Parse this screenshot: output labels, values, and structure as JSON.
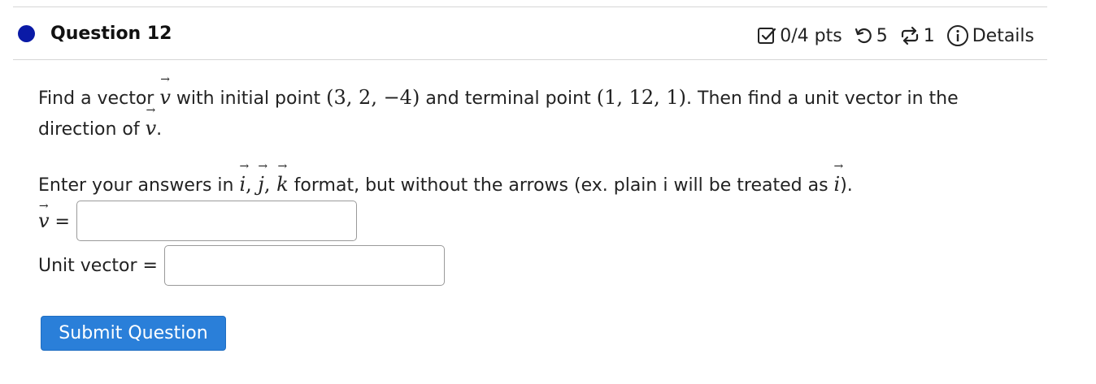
{
  "question": {
    "title": "Question 12"
  },
  "meta": {
    "points": "0/4 pts",
    "attempts_left": "5",
    "versions": "1",
    "details": "Details"
  },
  "body": {
    "p1_a": "Find a vector ",
    "p1_b": " with initial point ",
    "initial_point": "(3, 2, −4)",
    "p1_c": " and terminal point ",
    "terminal_point": "(1, 12, 1)",
    "p1_d": ". Then find a unit vector in the",
    "p1_e": "direction of ",
    "p1_f": ".",
    "p2_a": "Enter your answers in ",
    "p2_b": " format, but without the arrows (ex. plain i will be treated as ",
    "p2_c": ").",
    "vec_v": "v",
    "vec_i": "i",
    "vec_j": "j",
    "vec_k": "k",
    "comma": ", "
  },
  "answers": {
    "v_label_eq": " =",
    "v_value": "",
    "unit_label": "Unit vector =",
    "unit_value": ""
  },
  "actions": {
    "submit": "Submit Question"
  },
  "colors": {
    "status_dot": "#0a1aa6",
    "submit_bg": "#2a7fd9"
  },
  "icons": [
    "checkbox-icon",
    "retry-icon",
    "versions-icon",
    "info-icon"
  ]
}
